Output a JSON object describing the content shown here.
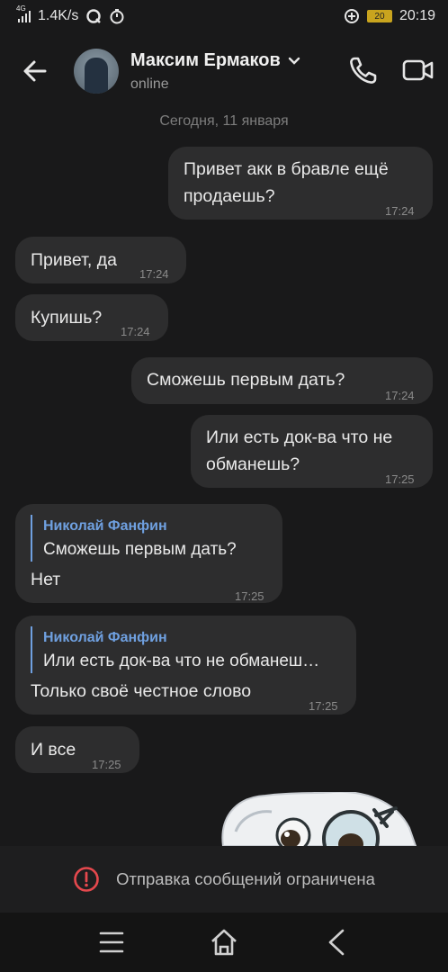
{
  "status_bar": {
    "network": "4G",
    "speed": "1.4K/s",
    "battery": "20",
    "time": "20:19"
  },
  "header": {
    "name": "Максим Ермаков",
    "status": "online"
  },
  "date_divider": "Сегодня, 11 января",
  "messages": [
    {
      "text1": "Привет акк в бравле ещё",
      "text2": "продаешь?",
      "time": "17:24"
    },
    {
      "text1": "Привет, да",
      "time": "17:24"
    },
    {
      "text1": "Купишь?",
      "time": "17:24"
    },
    {
      "text1": "Сможешь первым дать?",
      "time": "17:24"
    },
    {
      "text1": "Или есть док-ва что не",
      "text2": "обманешь?",
      "time": "17:25"
    },
    {
      "reply_name": "Николай Фанфин",
      "reply_text": "Сможешь первым дать?",
      "text1": "Нет",
      "time": "17:25"
    },
    {
      "reply_name": "Николай Фанфин",
      "reply_text": "Или есть док-ва что не обманеш…",
      "text1": "Только своё честное слово",
      "time": "17:25"
    },
    {
      "text1": "И все",
      "time": "17:25"
    }
  ],
  "restricted_notice": "Отправка сообщений ограничена",
  "colors": {
    "background": "#19191a",
    "bubble": "#2d2d2e",
    "reply_accent": "#6fa0e0",
    "warning": "#e5484d"
  }
}
